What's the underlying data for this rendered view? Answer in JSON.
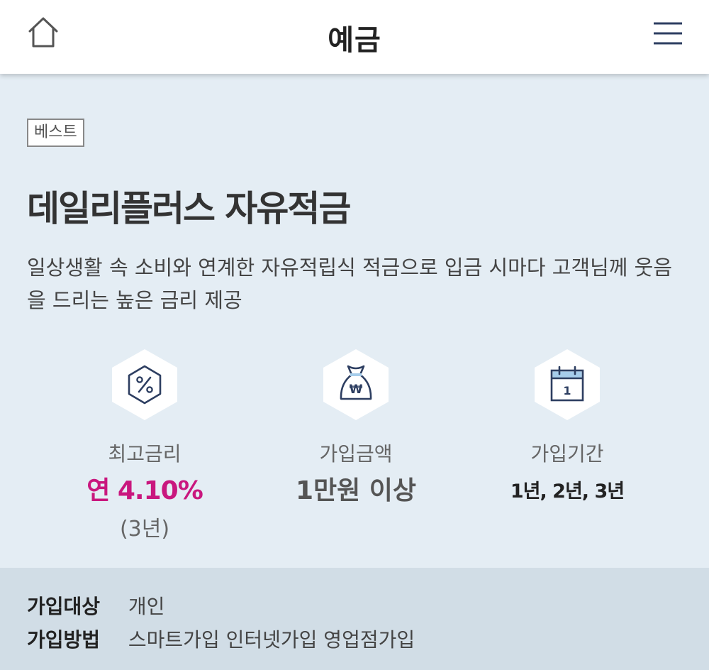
{
  "header": {
    "title": "예금",
    "home_icon": "home-icon",
    "menu_icon": "hamburger-menu-icon"
  },
  "product": {
    "badge": "베스트",
    "name": "데일리플러스 자유적금",
    "description": "일상생활 속 소비와 연계한 자유적립식 적금으로 입금 시마다 고객님께 웃음을 드리는 높은 금리 제공"
  },
  "features": {
    "max_rate": {
      "icon": "percent-icon",
      "label": "최고금리",
      "value": "연 4.10%",
      "note": "(3년)"
    },
    "amount": {
      "icon": "money-bag-icon",
      "label": "가입금액",
      "value": "1만원 이상"
    },
    "period": {
      "icon": "calendar-icon",
      "label": "가입기간",
      "value": "1년, 2년, 3년",
      "calendar_day": "1"
    }
  },
  "info": {
    "target": {
      "key": "가입대상",
      "value": "개인"
    },
    "method": {
      "key": "가입방법",
      "value": "스마트가입 인터넷가입 영업점가입"
    }
  },
  "colors": {
    "background": "#e4edf4",
    "info_background": "#d1dde6",
    "rate_accent": "#c9177e",
    "icon_navy": "#2d3e61"
  }
}
